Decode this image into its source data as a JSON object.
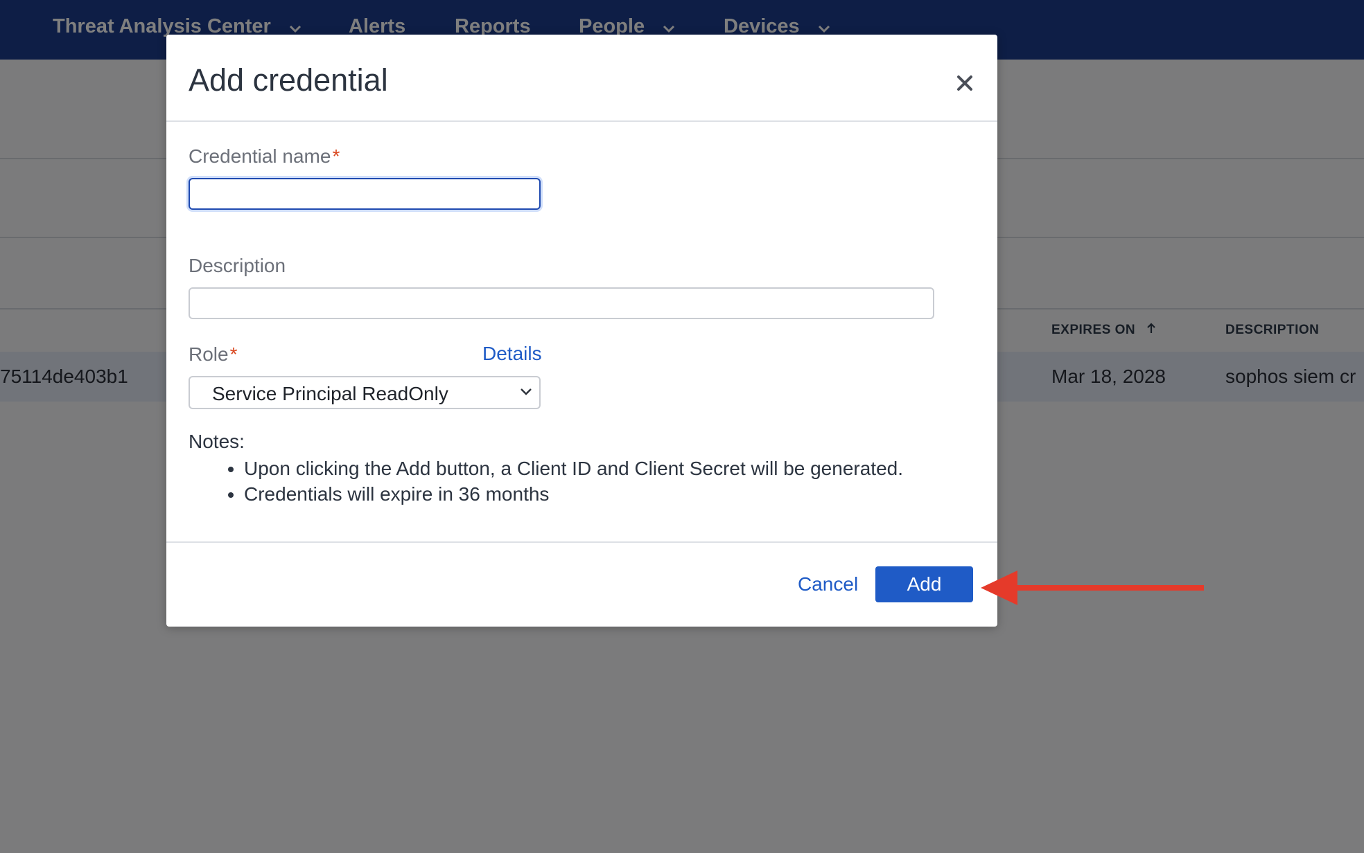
{
  "nav": {
    "items": [
      {
        "label": "Threat Analysis Center",
        "dropdown": true
      },
      {
        "label": "Alerts",
        "dropdown": false
      },
      {
        "label": "Reports",
        "dropdown": false
      },
      {
        "label": "People",
        "dropdown": true
      },
      {
        "label": "Devices",
        "dropdown": true
      }
    ]
  },
  "table": {
    "headers": {
      "expires_on": "EXPIRES ON",
      "description": "DESCRIPTION"
    },
    "row": {
      "client_id_fragment": "75114de403b1",
      "expires_on": "Mar 18, 2028",
      "description": "sophos siem cr"
    }
  },
  "modal": {
    "title": "Add credential",
    "credential_name": {
      "label": "Credential name",
      "required_mark": "*",
      "value": ""
    },
    "description": {
      "label": "Description",
      "value": ""
    },
    "role": {
      "label": "Role",
      "required_mark": "*",
      "details_link": "Details",
      "selected": "Service Principal ReadOnly"
    },
    "notes": {
      "title": "Notes:",
      "items": [
        "Upon clicking the Add button, a Client ID and Client Secret will be generated.",
        "Credentials will expire in 36 months"
      ]
    },
    "cancel_label": "Cancel",
    "add_label": "Add"
  },
  "annotation": {
    "arrow_color": "#e53a2a"
  },
  "colors": {
    "nav_bg": "#1c3d8c",
    "primary": "#1f5bc6",
    "required": "#d9471f"
  }
}
